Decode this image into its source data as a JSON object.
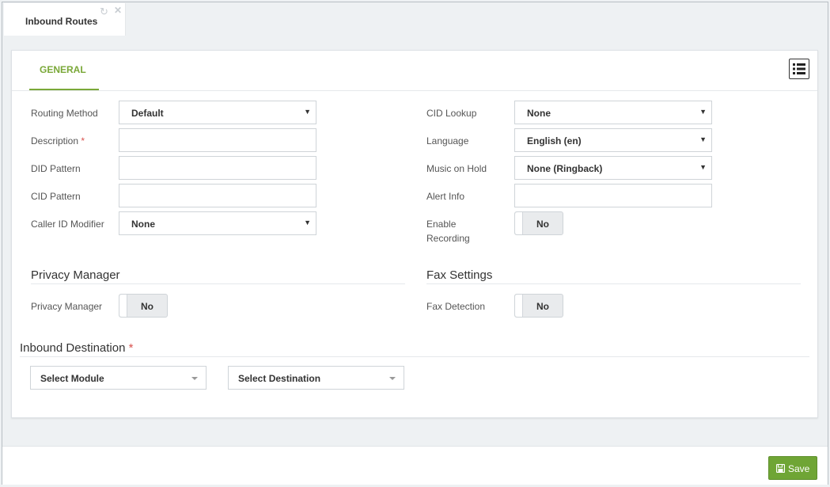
{
  "tab": {
    "title": "Inbound Routes"
  },
  "panel": {
    "general_tab": "GENERAL"
  },
  "left": {
    "routing_method": {
      "label": "Routing Method",
      "value": "Default"
    },
    "description": {
      "label": "Description",
      "required": "*",
      "value": ""
    },
    "did_pattern": {
      "label": "DID Pattern",
      "value": ""
    },
    "cid_pattern": {
      "label": "CID Pattern",
      "value": ""
    },
    "caller_id_modifier": {
      "label": "Caller ID Modifier",
      "value": "None"
    }
  },
  "right": {
    "cid_lookup": {
      "label": "CID Lookup",
      "value": "None"
    },
    "language": {
      "label": "Language",
      "value": "English (en)"
    },
    "music_on_hold": {
      "label": "Music on Hold",
      "value": "None (Ringback)"
    },
    "alert_info": {
      "label": "Alert Info",
      "value": ""
    },
    "enable_recording": {
      "label_line1": "Enable",
      "label_line2": "Recording",
      "value": "No"
    }
  },
  "privacy": {
    "title": "Privacy Manager",
    "label": "Privacy Manager",
    "value": "No"
  },
  "fax": {
    "title": "Fax Settings",
    "label": "Fax Detection",
    "value": "No"
  },
  "inbound_destination": {
    "title": "Inbound Destination",
    "required": "*",
    "module_placeholder": "Select Module",
    "destination_placeholder": "Select Destination"
  },
  "footer": {
    "save_label": "Save"
  },
  "colors": {
    "accent": "#7aa838",
    "save": "#6fa535",
    "required": "#d9534f"
  }
}
